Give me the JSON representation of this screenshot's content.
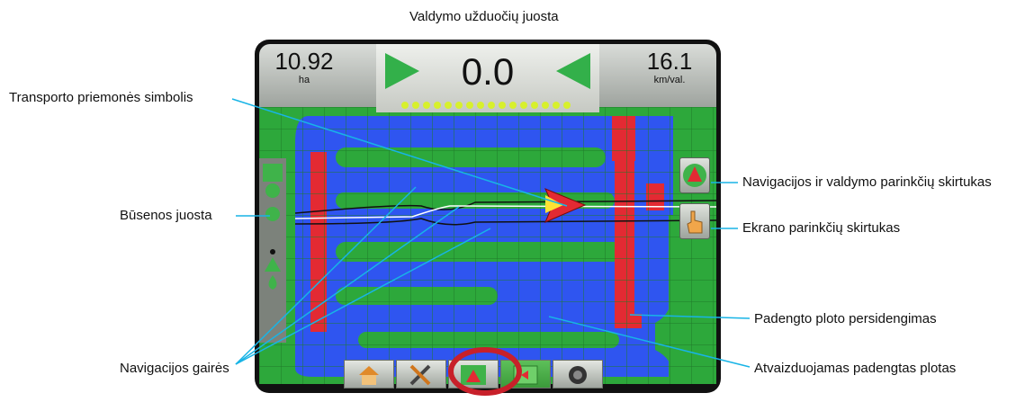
{
  "callouts": {
    "control_bar": "Valdymo užduočių juosta",
    "vehicle_symbol": "Transporto priemonės simbolis",
    "status_bar": "Būsenos juosta",
    "guide_lines": "Navigacijos gairės",
    "nav_options_tab": "Navigacijos ir valdymo parinkčių skirtukas",
    "display_options_tab": "Ekrano parinkčių skirtukas",
    "overlap": "Padengto ploto persidengimas",
    "coverage": "Atvaizduojamas padengtas plotas"
  },
  "topbar": {
    "area_value": "10.92",
    "area_unit": "ha",
    "guidance_value": "0.0",
    "speed_value": "16.1",
    "speed_unit": "km/val."
  },
  "colors": {
    "callout_line": "#18b4e6",
    "coverage": "#2f55f0",
    "overlap": "#e32a33",
    "field": "#2da83b",
    "highlight_ring": "#c8202a"
  },
  "icons": {
    "left_arrow": "green-right-triangle-icon",
    "right_arrow": "green-left-triangle-icon",
    "home": "home-icon",
    "tools": "tools-icon",
    "guidance": "guidance-icon",
    "map": "map-icon",
    "camera": "camera-icon",
    "nav_tab": "nav-options-icon",
    "display_tab": "display-options-icon"
  }
}
